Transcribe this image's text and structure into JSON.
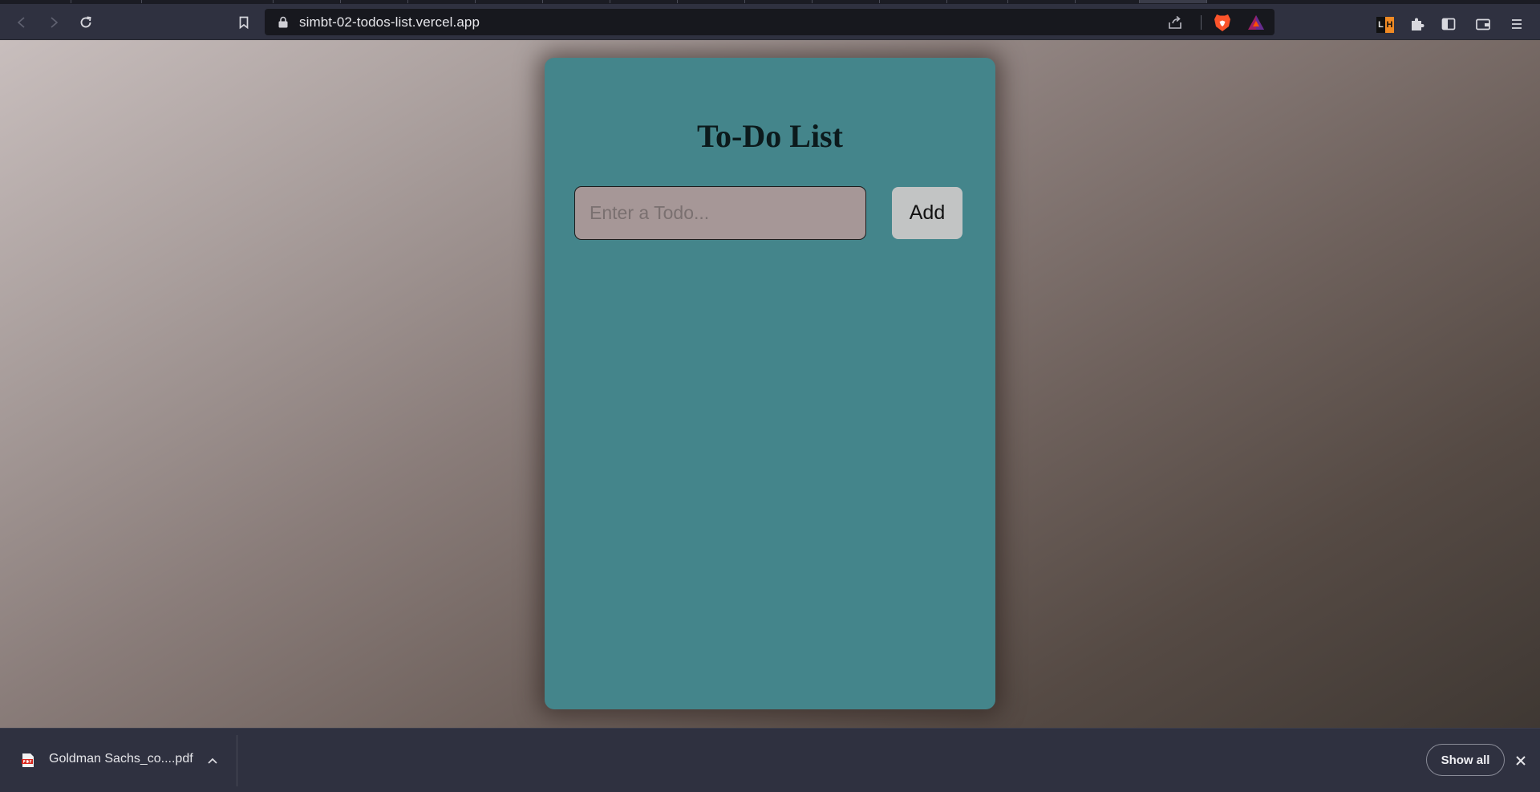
{
  "browser": {
    "url": "simbt-02-todos-list.vercel.app",
    "icons": {
      "back": "arrow-left-icon",
      "forward": "arrow-right-icon",
      "reload": "reload-icon",
      "bookmark": "bookmark-icon",
      "lock": "lock-icon",
      "share": "share-icon",
      "brave_shields": "brave-lion-icon",
      "brave_rewards": "bat-triangle-icon",
      "extension_lh": "lh-extension-icon",
      "extensions": "puzzle-icon",
      "sidebar": "sidebar-icon",
      "wallet": "wallet-icon",
      "menu": "hamburger-menu-icon"
    },
    "extension_lh_letters": [
      "L",
      "H"
    ]
  },
  "app": {
    "title": "To-Do List",
    "input_placeholder": "Enter a Todo...",
    "input_value": "",
    "add_label": "Add",
    "todos": [],
    "colors": {
      "card": "#44858b",
      "input": "#a69797",
      "button": "#c2c4c4"
    }
  },
  "download_shelf": {
    "item_name": "Goldman Sachs_co....pdf",
    "item_icon": "pdf-file-icon",
    "show_all_label": "Show all",
    "close_icon": "close-icon"
  }
}
